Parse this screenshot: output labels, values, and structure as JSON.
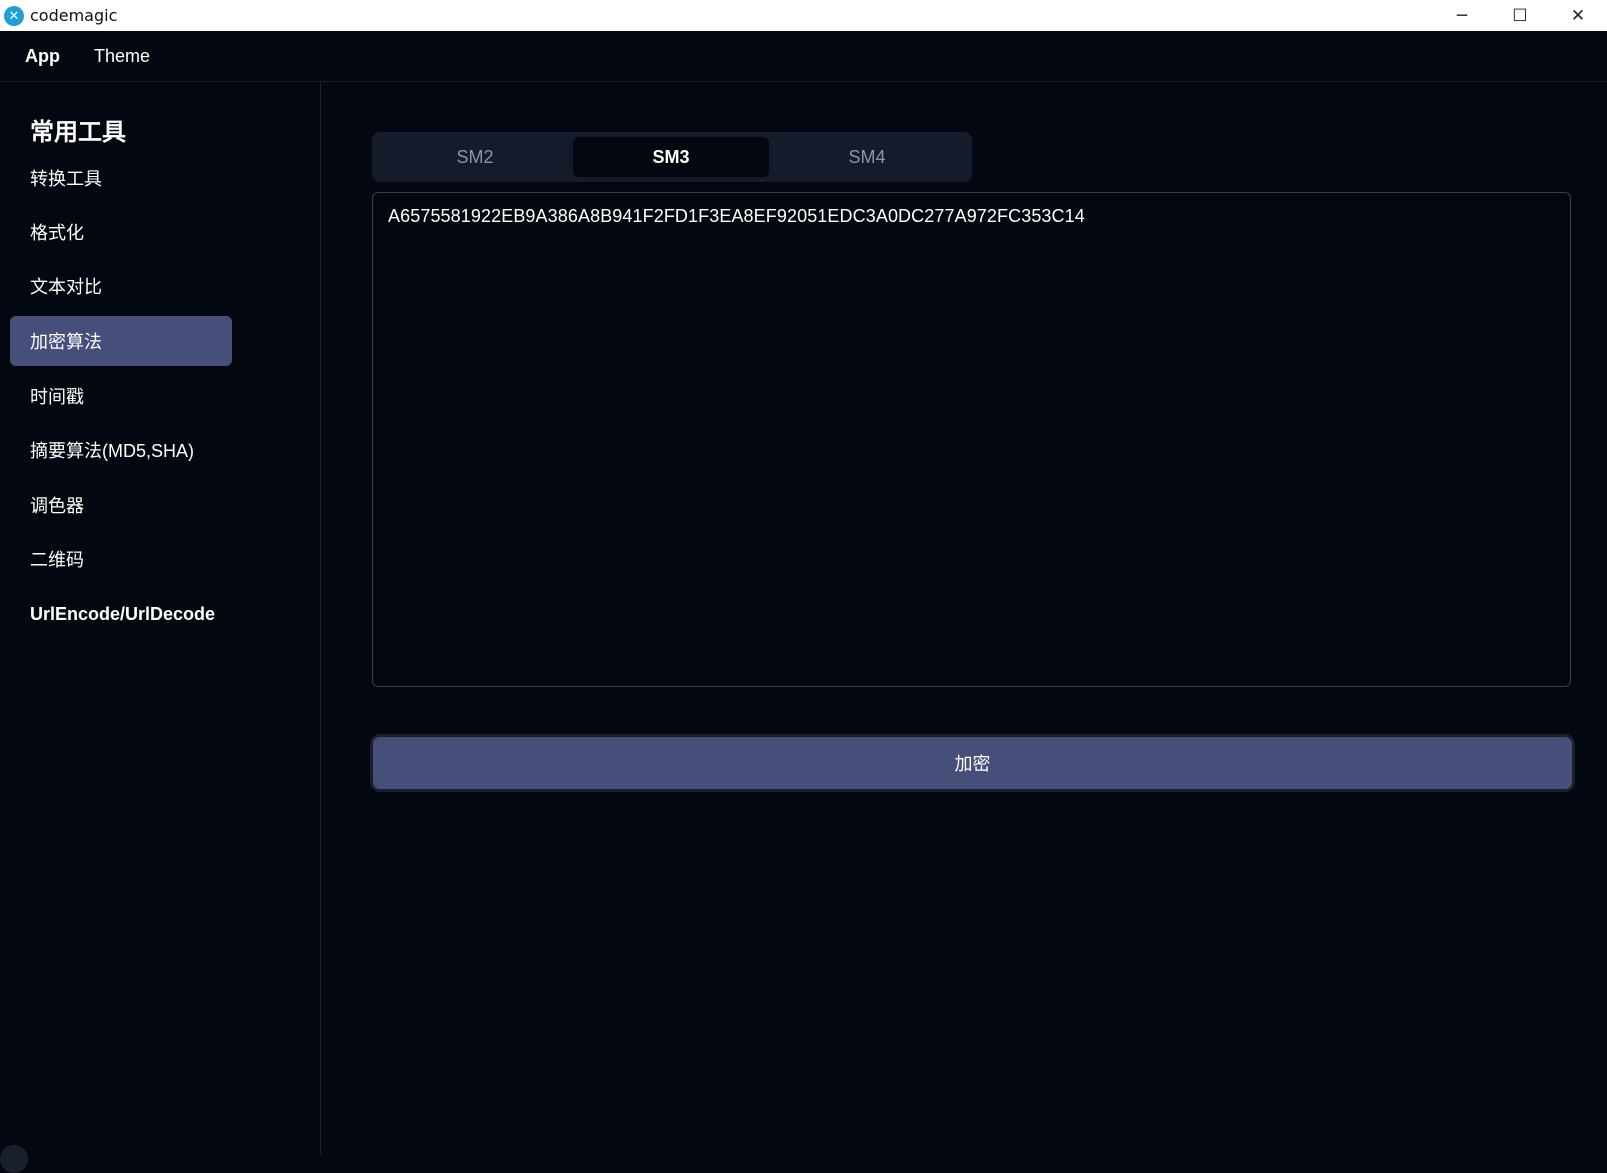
{
  "window": {
    "title": "codemagic",
    "logo_glyph": "✕",
    "controls": {
      "minimize": "─",
      "maximize": "☐",
      "close": "✕"
    }
  },
  "menubar": {
    "items": [
      {
        "label": "App"
      },
      {
        "label": "Theme"
      }
    ]
  },
  "sidebar": {
    "title": "常用工具",
    "items": [
      {
        "label": "转换工具"
      },
      {
        "label": "格式化"
      },
      {
        "label": "文本对比"
      },
      {
        "label": "加密算法",
        "active": true
      },
      {
        "label": "时间戳"
      },
      {
        "label": "摘要算法(MD5,SHA)"
      },
      {
        "label": "调色器"
      },
      {
        "label": "二维码"
      },
      {
        "label": "UrlEncode/UrlDecode"
      }
    ]
  },
  "main": {
    "tabs": [
      {
        "label": "SM2"
      },
      {
        "label": "SM3",
        "active": true
      },
      {
        "label": "SM4"
      }
    ],
    "output_value": "A6575581922EB9A386A8B941F2FD1F3EA8EF92051EDC3A0DC277A972FC353C14",
    "encrypt_button_label": "加密"
  },
  "colors": {
    "background": "#03070f",
    "accent": "#464f79",
    "tab_bar": "#161b2b",
    "border": "#3a3f4d"
  }
}
